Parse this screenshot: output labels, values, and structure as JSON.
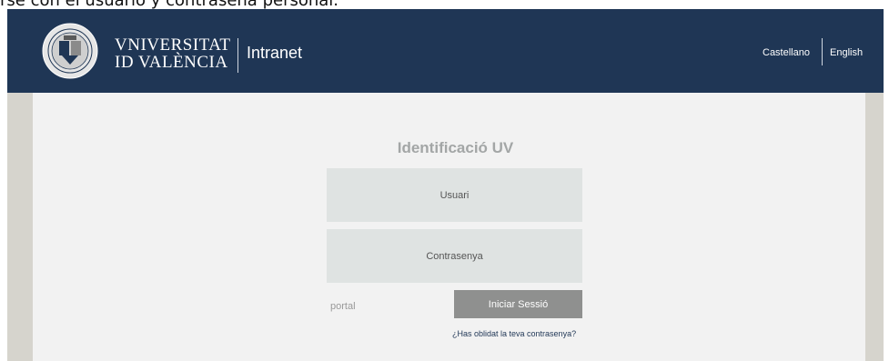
{
  "document": {
    "caption": "rse con el usuario y contraseña personal."
  },
  "header": {
    "brand_line1": "VNIVERSITAT",
    "brand_line2": "ID VALÈNCIA",
    "app_title": "Intranet",
    "languages": [
      "Castellano",
      "English"
    ]
  },
  "login": {
    "title": "Identificació UV",
    "username_placeholder": "Usuari",
    "password_placeholder": "Contrasenya",
    "portal_label": "portal",
    "submit_label": "Iniciar Sessió",
    "forgot_link": "¿Has oblidat la teva contrasenya?"
  },
  "colors": {
    "header_bg": "#1f3655",
    "panel_bg": "#f2f2f2",
    "field_bg": "#dfe3e2",
    "button_bg": "#8f908f",
    "side_bg": "#d6d4cd"
  },
  "icons": {
    "seal": "university-seal-icon"
  }
}
